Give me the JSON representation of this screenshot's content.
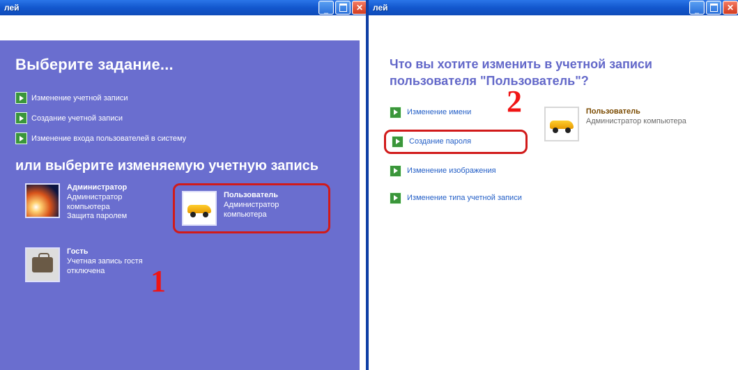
{
  "left": {
    "titlebar_suffix": "лей",
    "heading_tasks": "Выберите задание...",
    "tasks": [
      "Изменение учетной записи",
      "Создание учетной записи",
      "Изменение входа пользователей в систему"
    ],
    "heading_pick": "или выберите изменяемую учетную запись",
    "accounts": {
      "admin": {
        "name": "Администратор",
        "role1": "Администратор",
        "role2": "компьютера",
        "extra": "Защита паролем"
      },
      "user": {
        "name": "Пользователь",
        "role1": "Администратор",
        "role2": "компьютера"
      },
      "guest": {
        "name": "Гость",
        "line1": "Учетная запись гостя",
        "line2": "отключена"
      }
    },
    "callout_number": "1"
  },
  "right": {
    "titlebar_suffix": "лей",
    "heading": "Что вы хотите изменить в учетной записи пользователя \"Пользователь\"?",
    "links": [
      "Изменение имени",
      "Создание пароля",
      "Изменение изображения",
      "Изменение типа учетной записи"
    ],
    "callout_number": "2",
    "user": {
      "name": "Пользователь",
      "role": "Администратор компьютера"
    }
  }
}
